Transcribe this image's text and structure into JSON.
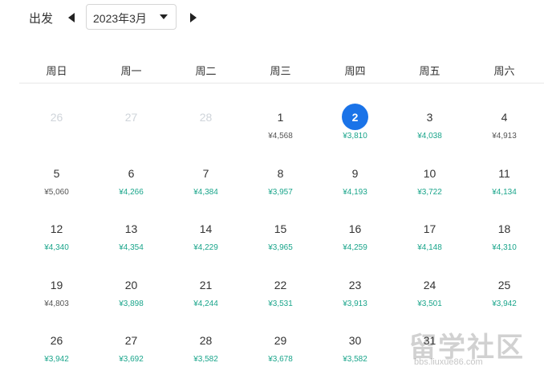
{
  "header": {
    "depart_label": "出发",
    "month_value": "2023年3月"
  },
  "weekdays": [
    "周日",
    "周一",
    "周二",
    "周三",
    "周四",
    "周五",
    "周六"
  ],
  "colors": {
    "accent": "#1a73e8",
    "low_price": "#1aa58b",
    "normal_price": "#555555",
    "muted": "#cfd4da"
  },
  "calendar": {
    "weeks": [
      [
        {
          "day": "26",
          "price": "",
          "state": "muted"
        },
        {
          "day": "27",
          "price": "",
          "state": "muted"
        },
        {
          "day": "28",
          "price": "",
          "state": "muted"
        },
        {
          "day": "1",
          "price": "¥4,568",
          "state": "high"
        },
        {
          "day": "2",
          "price": "¥3,810",
          "state": "selected"
        },
        {
          "day": "3",
          "price": "¥4,038",
          "state": "low"
        },
        {
          "day": "4",
          "price": "¥4,913",
          "state": "high"
        }
      ],
      [
        {
          "day": "5",
          "price": "¥5,060",
          "state": "high"
        },
        {
          "day": "6",
          "price": "¥4,266",
          "state": "low"
        },
        {
          "day": "7",
          "price": "¥4,384",
          "state": "low"
        },
        {
          "day": "8",
          "price": "¥3,957",
          "state": "low"
        },
        {
          "day": "9",
          "price": "¥4,193",
          "state": "low"
        },
        {
          "day": "10",
          "price": "¥3,722",
          "state": "low"
        },
        {
          "day": "11",
          "price": "¥4,134",
          "state": "low"
        }
      ],
      [
        {
          "day": "12",
          "price": "¥4,340",
          "state": "low"
        },
        {
          "day": "13",
          "price": "¥4,354",
          "state": "low"
        },
        {
          "day": "14",
          "price": "¥4,229",
          "state": "low"
        },
        {
          "day": "15",
          "price": "¥3,965",
          "state": "low"
        },
        {
          "day": "16",
          "price": "¥4,259",
          "state": "low"
        },
        {
          "day": "17",
          "price": "¥4,148",
          "state": "low"
        },
        {
          "day": "18",
          "price": "¥4,310",
          "state": "low"
        }
      ],
      [
        {
          "day": "19",
          "price": "¥4,803",
          "state": "high"
        },
        {
          "day": "20",
          "price": "¥3,898",
          "state": "low"
        },
        {
          "day": "21",
          "price": "¥4,244",
          "state": "low"
        },
        {
          "day": "22",
          "price": "¥3,531",
          "state": "low"
        },
        {
          "day": "23",
          "price": "¥3,913",
          "state": "low"
        },
        {
          "day": "24",
          "price": "¥3,501",
          "state": "low"
        },
        {
          "day": "25",
          "price": "¥3,942",
          "state": "low"
        }
      ],
      [
        {
          "day": "26",
          "price": "¥3,942",
          "state": "low"
        },
        {
          "day": "27",
          "price": "¥3,692",
          "state": "low"
        },
        {
          "day": "28",
          "price": "¥3,582",
          "state": "low"
        },
        {
          "day": "29",
          "price": "¥3,678",
          "state": "low"
        },
        {
          "day": "30",
          "price": "¥3,582",
          "state": "low"
        },
        {
          "day": "31",
          "price": "",
          "state": "low"
        },
        {
          "day": "",
          "price": "",
          "state": "empty"
        }
      ]
    ]
  },
  "watermark": {
    "text": "留学社区",
    "url": "bbs.liuxue86.com"
  }
}
